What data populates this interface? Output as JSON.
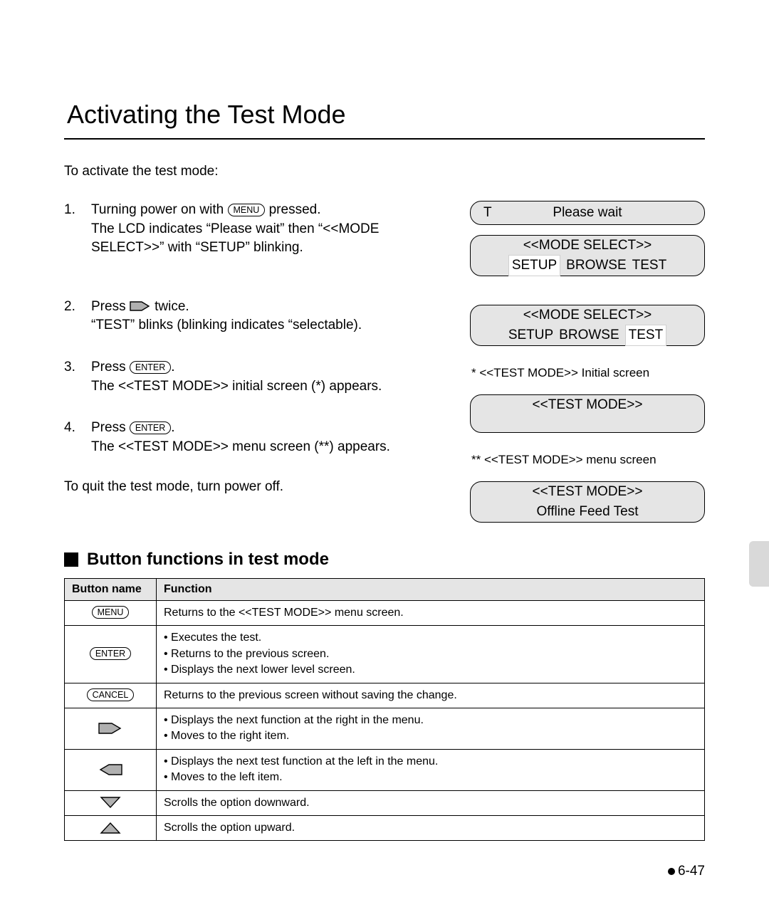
{
  "title": "Activating the Test Mode",
  "intro": "To activate the test mode:",
  "buttons": {
    "menu": "MENU",
    "enter": "ENTER",
    "cancel": "CANCEL"
  },
  "steps": [
    {
      "num": "1.",
      "pre": "Turning power on with ",
      "btn": "menu",
      "post": " pressed.",
      "line2": "The LCD indicates “Please wait” then “<<MODE SELECT>>” with “SETUP” blinking."
    },
    {
      "num": "2.",
      "pre": "Press ",
      "arrow": "right",
      "post": " twice.",
      "line2": "“TEST” blinks (blinking indicates “selectable)."
    },
    {
      "num": "3.",
      "pre": "Press ",
      "btn": "enter",
      "post": ".",
      "line2": "The <<TEST MODE>> initial screen (*) appears."
    },
    {
      "num": "4.",
      "pre": "Press ",
      "btn": "enter",
      "post": ".",
      "line2": "The <<TEST MODE>> menu screen (**) appears."
    }
  ],
  "quit": "To quit the test mode, turn power off.",
  "lcds": {
    "l1t": "T",
    "l1": "Please wait",
    "l2top": "<<MODE SELECT>>",
    "l2_setup": "SETUP",
    "l2_browse": "BROWSE",
    "l2_test": "TEST",
    "cap1": "* <<TEST MODE>> Initial screen",
    "l4": "<<TEST MODE>>",
    "cap2": "** <<TEST MODE>> menu screen",
    "l5a": "<<TEST MODE>>",
    "l5b": "Offline Feed Test"
  },
  "section_heading": "Button functions in test mode",
  "table_headers": {
    "col1": "Button name",
    "col2": "Function"
  },
  "table_rows": [
    {
      "icon": "menu",
      "text": "Returns to the <<TEST MODE>> menu screen."
    },
    {
      "icon": "enter",
      "text": "• Executes the test.\n• Returns to the previous screen.\n• Displays the next lower level screen."
    },
    {
      "icon": "cancel",
      "text": "Returns to the previous screen without saving the change."
    },
    {
      "icon": "right",
      "text": "• Displays the next function at the right in the menu.\n• Moves to the right item."
    },
    {
      "icon": "left",
      "text": "• Displays the next test function at the left in the menu.\n• Moves to the left item."
    },
    {
      "icon": "down",
      "text": "Scrolls the option downward."
    },
    {
      "icon": "up",
      "text": "Scrolls the option upward."
    }
  ],
  "page_number": "6-47"
}
